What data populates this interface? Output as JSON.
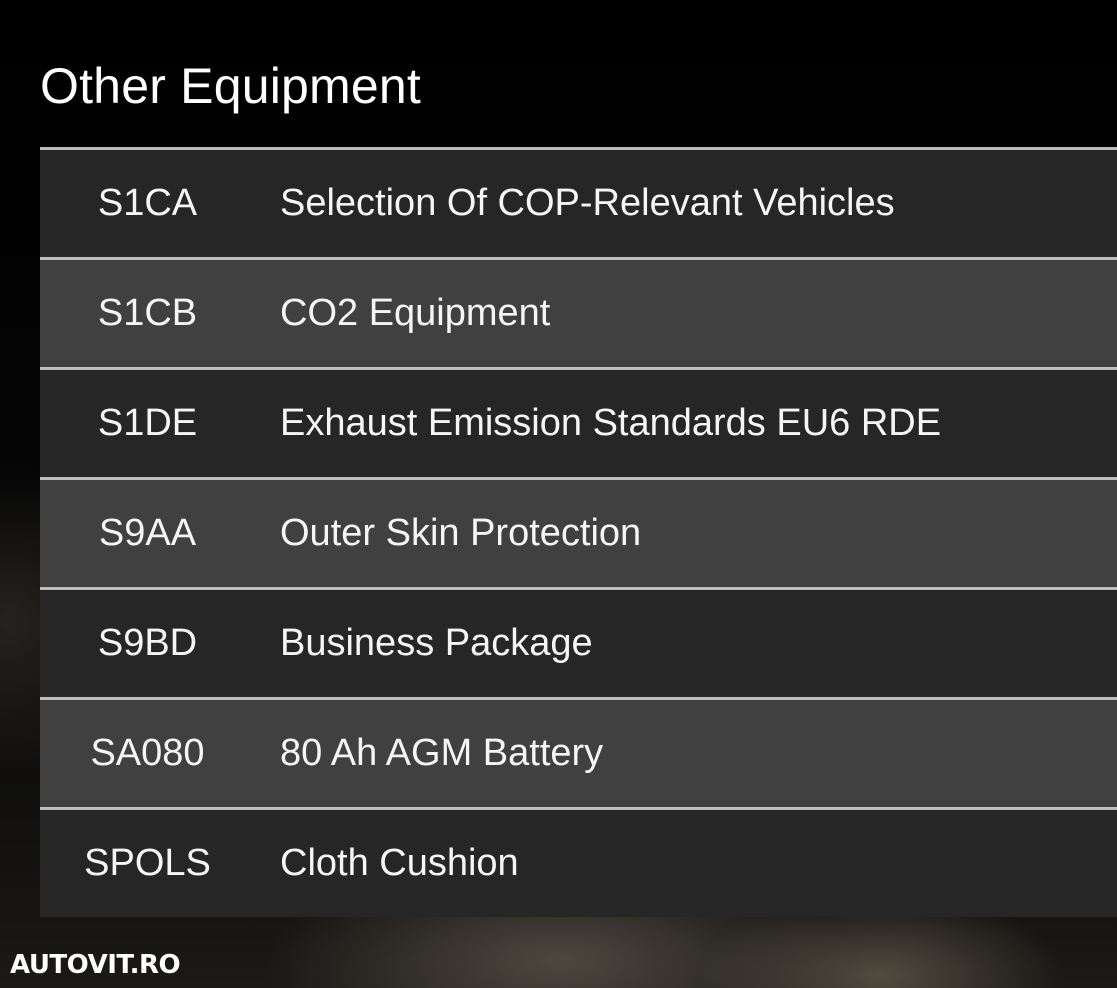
{
  "section": {
    "title": "Other Equipment"
  },
  "equipment": [
    {
      "code": "S1CA",
      "description": "Selection Of COP-Relevant Vehicles"
    },
    {
      "code": "S1CB",
      "description": "CO2 Equipment"
    },
    {
      "code": "S1DE",
      "description": "Exhaust Emission Standards EU6 RDE"
    },
    {
      "code": "S9AA",
      "description": "Outer Skin Protection"
    },
    {
      "code": "S9BD",
      "description": "Business Package"
    },
    {
      "code": "SA080",
      "description": "80 Ah AGM Battery"
    },
    {
      "code": "SPOLS",
      "description": "Cloth Cushion"
    }
  ],
  "watermark": {
    "text": "AUTOVIT.RO"
  },
  "colors": {
    "row_dark": "#262626",
    "row_light": "#404040",
    "separator": "#bdbdbd",
    "text": "#f5f5f5"
  }
}
